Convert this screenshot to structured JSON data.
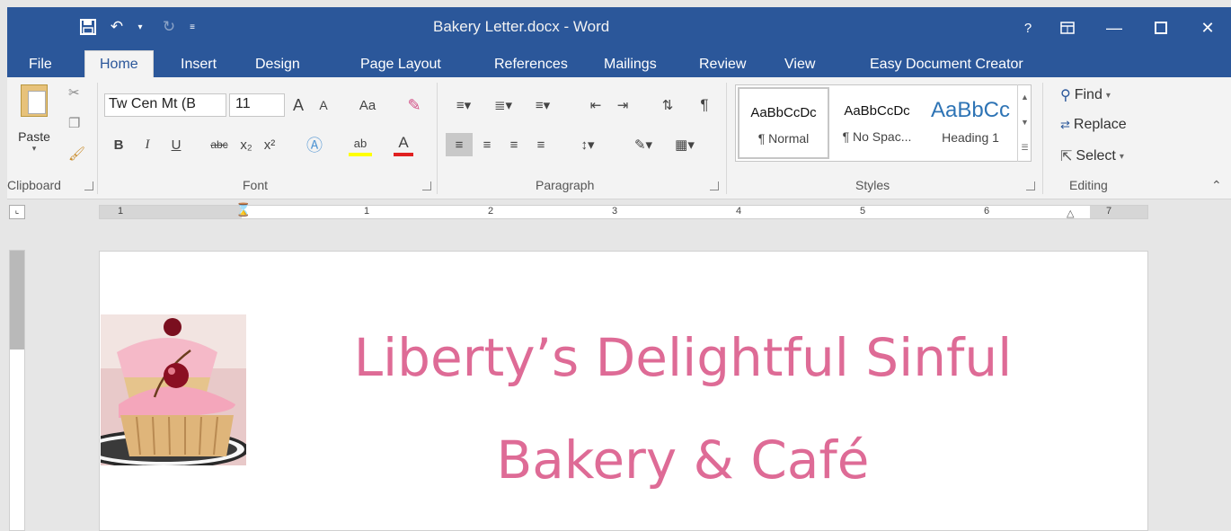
{
  "titlebar": {
    "doc_title": "Bakery Letter.docx - Word",
    "help": "?"
  },
  "tabs": [
    "File",
    "Home",
    "Insert",
    "Design",
    "Page Layout",
    "References",
    "Mailings",
    "Review",
    "View",
    "Easy Document Creator"
  ],
  "ribbon": {
    "clipboard": {
      "paste_label": "Paste",
      "group_label": "Clipboard"
    },
    "font": {
      "font_name": "Tw Cen Mt (B",
      "font_size": "11",
      "group_label": "Font",
      "bold": "B",
      "italic": "I",
      "underline": "U",
      "strike": "abc",
      "subscript": "x₂",
      "superscript": "x²",
      "grow": "A",
      "shrink": "A",
      "change_case": "Aa",
      "highlight": "ab",
      "font_color": "A"
    },
    "paragraph": {
      "group_label": "Paragraph",
      "pilcrow": "¶"
    },
    "styles": {
      "group_label": "Styles",
      "items": [
        {
          "sample": "AaBbCcDc",
          "name": "¶ Normal"
        },
        {
          "sample": "AaBbCcDc",
          "name": "¶ No Spac..."
        },
        {
          "sample": "AaBbCc",
          "name": "Heading 1"
        }
      ]
    },
    "editing": {
      "group_label": "Editing",
      "find": "Find",
      "replace": "Replace",
      "select": "Select"
    }
  },
  "ruler": {
    "numbers": [
      "1",
      "1",
      "2",
      "3",
      "4",
      "5",
      "6",
      "7"
    ]
  },
  "document": {
    "heading_line1": "Liberty’s Delightful Sinful",
    "heading_line2": "Bakery & Café"
  },
  "colors": {
    "word_blue": "#2b579a",
    "heading_pink": "#de6b96"
  }
}
